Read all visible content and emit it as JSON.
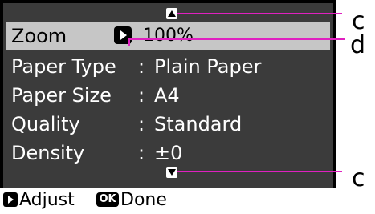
{
  "screen": {
    "rows": [
      {
        "label": "Zoom",
        "colon": "",
        "value": "",
        "selected": true
      },
      {
        "label": "Paper Type",
        "colon": ":",
        "value": "Plain Paper"
      },
      {
        "label": "Paper Size",
        "colon": ":",
        "value": "A4"
      },
      {
        "label": "Quality",
        "colon": ":",
        "value": "Standard"
      },
      {
        "label": "Density",
        "colon": ":",
        "value": "±0"
      }
    ],
    "zoom_value": "100%",
    "icons": {
      "up": "triangle-up-icon",
      "down": "triangle-down-icon",
      "play": "play-icon"
    }
  },
  "bottom_bar": {
    "adjust_label": "Adjust",
    "ok_badge": "OK",
    "done_label": "Done"
  },
  "callouts": {
    "top": "c",
    "middle": "d",
    "bottom": "c"
  },
  "colors": {
    "callout": "#e020c0",
    "highlight": "#c6c6c6",
    "screen_bg": "#3b3b3b"
  }
}
